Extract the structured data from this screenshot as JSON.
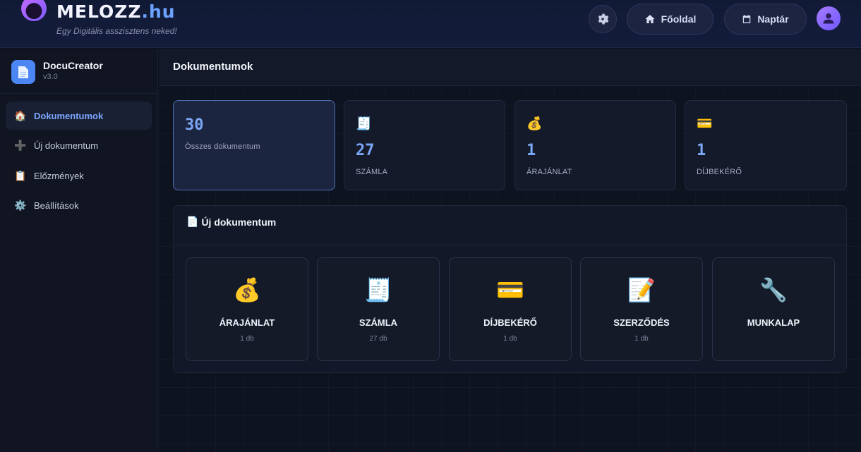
{
  "header": {
    "logo_main": "MELOZZ",
    "logo_domain": ".hu",
    "tagline": "Egy Digitális asszisztens neked!",
    "settings_icon": "gear-icon",
    "home_label": "Főoldal",
    "home_icon": "house-icon",
    "calendar_label": "Naptár",
    "calendar_icon": "calendar-icon",
    "avatar_icon": "user-icon"
  },
  "sidebar": {
    "app_name": "DocuCreator",
    "app_version": "v3.0",
    "items": [
      {
        "label": "Dokumentumok",
        "icon": "🏠"
      },
      {
        "label": "Új dokumentum",
        "icon": "➕"
      },
      {
        "label": "Előzmények",
        "icon": "📋"
      },
      {
        "label": "Beállítások",
        "icon": "⚙️"
      }
    ]
  },
  "main": {
    "title": "Dokumentumok",
    "stats": [
      {
        "value": "30",
        "label": "Összes dokumentum",
        "icon": ""
      },
      {
        "value": "27",
        "label": "SZÁMLA",
        "icon": "🧾"
      },
      {
        "value": "1",
        "label": "ÁRAJÁNLAT",
        "icon": "💰"
      },
      {
        "value": "1",
        "label": "DÍJBEKÉRŐ",
        "icon": "💳"
      }
    ],
    "new_doc": {
      "icon": "📄",
      "title": "Új dokumentum",
      "tiles": [
        {
          "icon": "💰",
          "name": "ÁRAJÁNLAT",
          "count": "1 db"
        },
        {
          "icon": "🧾",
          "name": "SZÁMLA",
          "count": "27 db"
        },
        {
          "icon": "💳",
          "name": "DÍJBEKÉRŐ",
          "count": "1 db"
        },
        {
          "icon": "📝",
          "name": "SZERZŐDÉS",
          "count": "1 db"
        },
        {
          "icon": "🔧",
          "name": "MUNKALAP",
          "count": ""
        }
      ]
    }
  },
  "colors": {
    "accent": "#7aa6f4",
    "brand_purple": "#a77bff",
    "background": "#0e1320"
  }
}
